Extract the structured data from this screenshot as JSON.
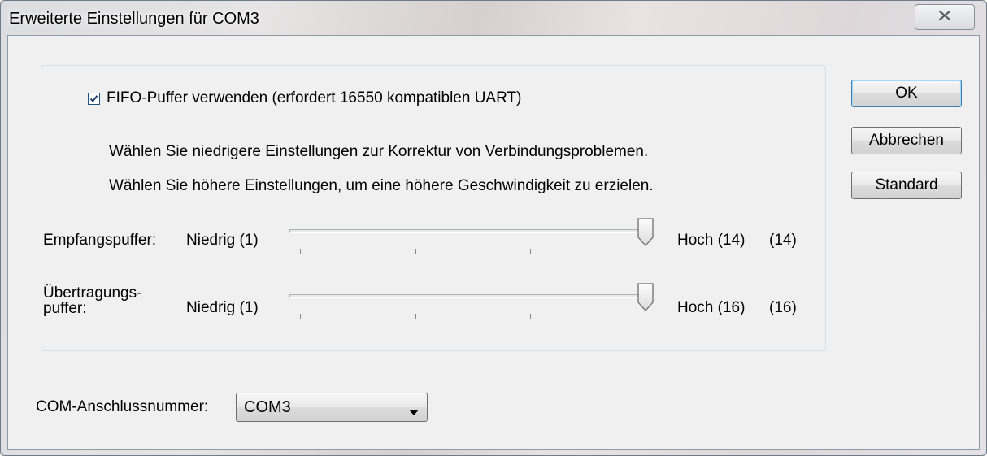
{
  "window": {
    "title": "Erweiterte Einstellungen für COM3",
    "close_icon": "close-x-icon"
  },
  "fifo": {
    "checkbox_label": "FIFO-Puffer verwenden (erfordert 16550 kompatiblen UART)",
    "checked": true,
    "hint_lower": "Wählen Sie niedrigere Einstellungen zur Korrektur von Verbindungsproblemen.",
    "hint_higher": "Wählen Sie höhere Einstellungen, um eine höhere Geschwindigkeit zu erzielen."
  },
  "receive_buffer": {
    "label": "Empfangspuffer:",
    "min_label": "Niedrig (1)",
    "max_label": "Hoch (14)",
    "current_value": "(14)",
    "min": 1,
    "max": 14,
    "value": 14
  },
  "transmit_buffer": {
    "label_line1": "Übertragungs-",
    "label_line2": "puffer:",
    "min_label": "Niedrig (1)",
    "max_label": "Hoch (16)",
    "current_value": "(16)",
    "min": 1,
    "max": 16,
    "value": 16
  },
  "com_port": {
    "label": "COM-Anschlussnummer:",
    "value": "COM3"
  },
  "buttons": {
    "ok": "OK",
    "cancel": "Abbrechen",
    "default": "Standard"
  }
}
